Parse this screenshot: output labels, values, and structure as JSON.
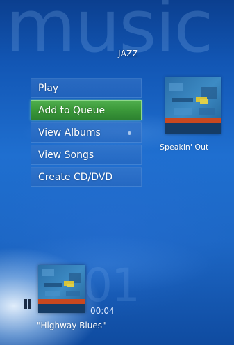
{
  "header": {
    "watermark": "music",
    "category": "JAZZ"
  },
  "menu": {
    "items": [
      {
        "label": "Play"
      },
      {
        "label": "Add to Queue"
      },
      {
        "label": "View Albums"
      },
      {
        "label": "View Songs"
      },
      {
        "label": "Create CD/DVD"
      }
    ],
    "selected_index": 1
  },
  "album": {
    "title": "Speakin' Out",
    "art_icon": "album-cover"
  },
  "now_playing": {
    "state_icon": "pause-icon",
    "track_number": "01",
    "elapsed": "00:04",
    "title": "\"Highway Blues\""
  },
  "colors": {
    "background_top": "#0b3f8f",
    "background_mid": "#1f6fd0",
    "selected_item": "#3c9a3a",
    "selected_border": "#8ed88a",
    "text": "#ffffff"
  }
}
